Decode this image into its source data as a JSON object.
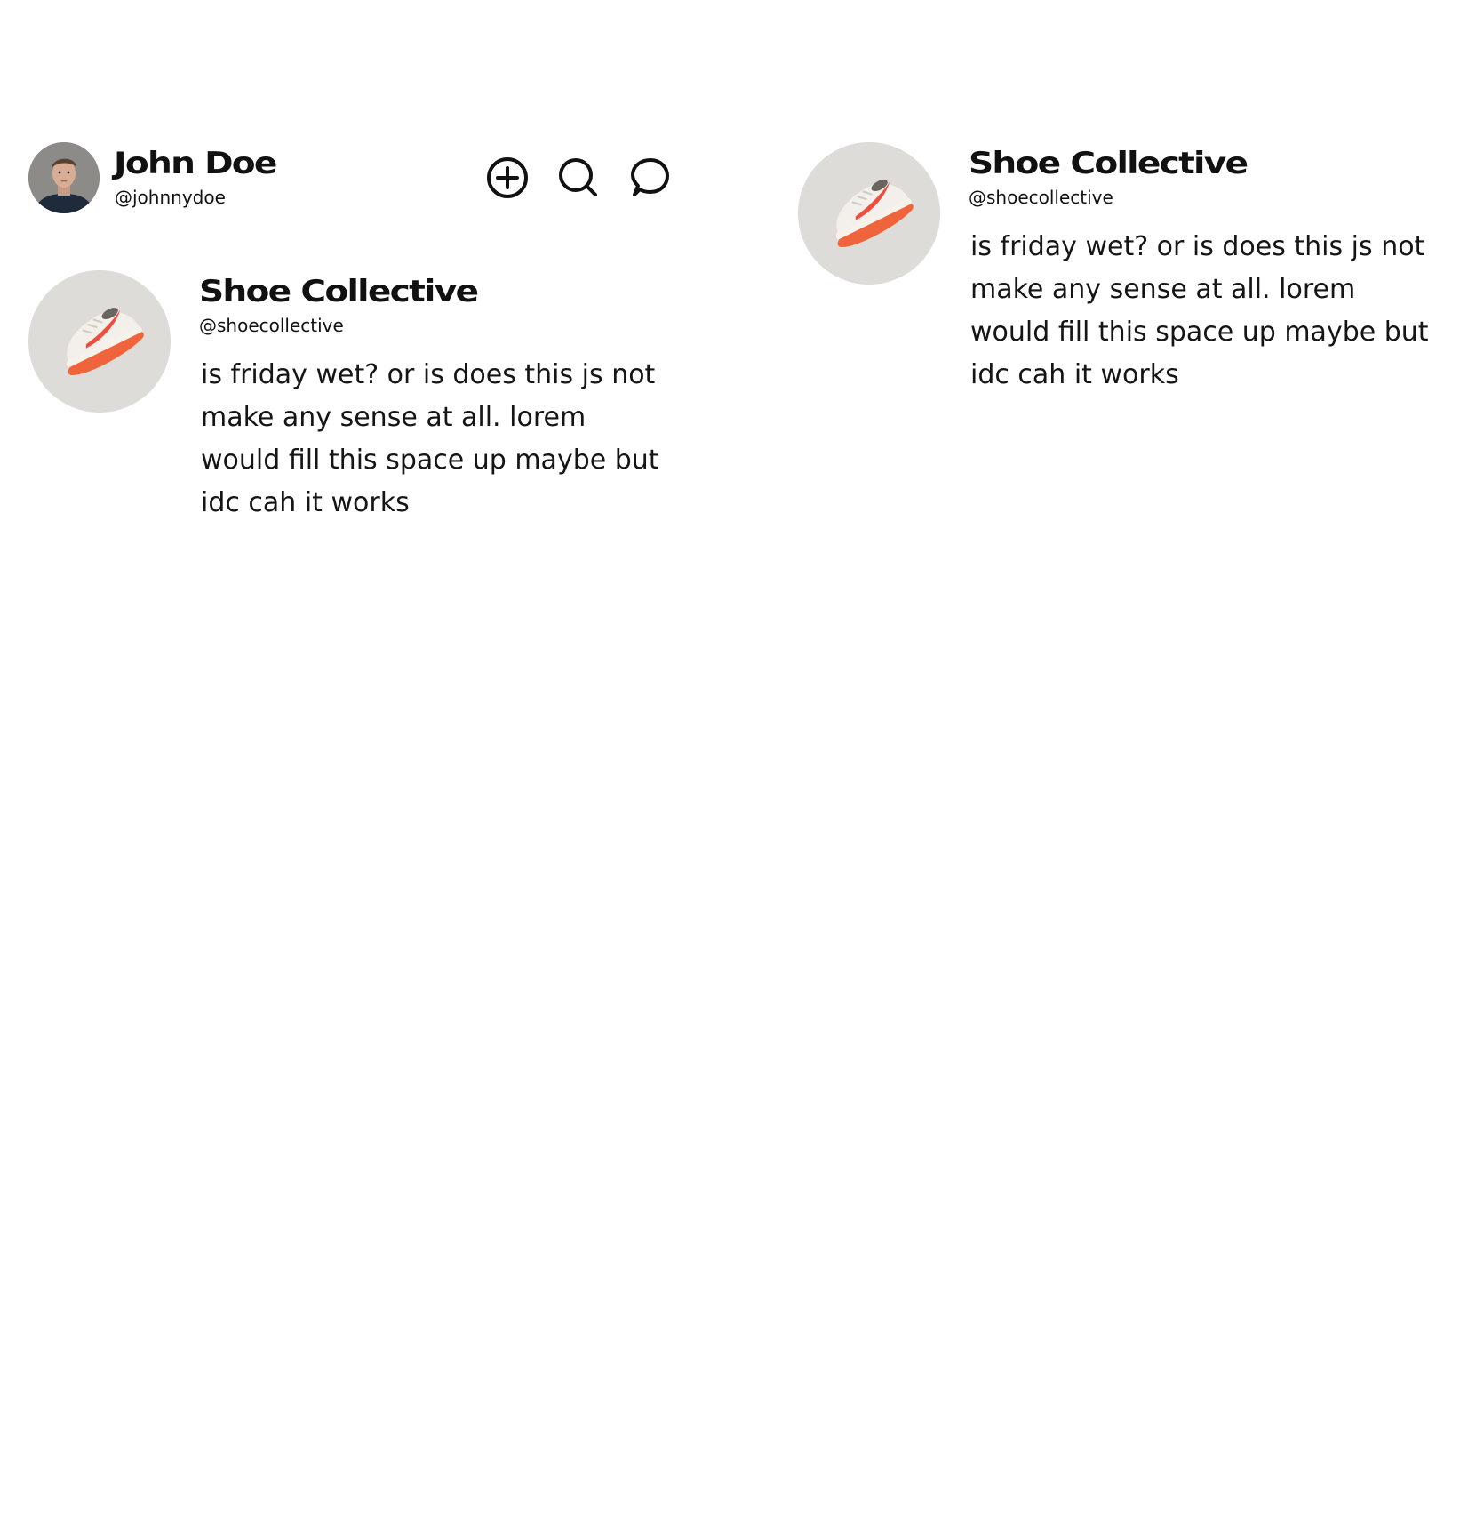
{
  "profile": {
    "name": "John Doe",
    "handle": "@johnnydoe",
    "avatar_icon": "user-avatar"
  },
  "header_actions": [
    {
      "icon": "plus-circle-icon"
    },
    {
      "icon": "search-icon"
    },
    {
      "icon": "chat-bubble-icon"
    }
  ],
  "posts": [
    {
      "author": "Shoe Collective",
      "handle": "@shoecollective",
      "text": "is friday wet? or is does this js not make any sense at all. lorem would fill this space up maybe but idc cah it works",
      "avatar_icon": "sneaker-avatar"
    },
    {
      "author": "Shoe Collective",
      "handle": "@shoecollective",
      "text": "is friday wet? or is does this js not make any sense at all. lorem would fill this space up maybe but idc cah it works",
      "avatar_icon": "sneaker-avatar"
    }
  ],
  "colors": {
    "text": "#111111",
    "background": "#ffffff",
    "sneaker_accent": "#f0643c"
  }
}
